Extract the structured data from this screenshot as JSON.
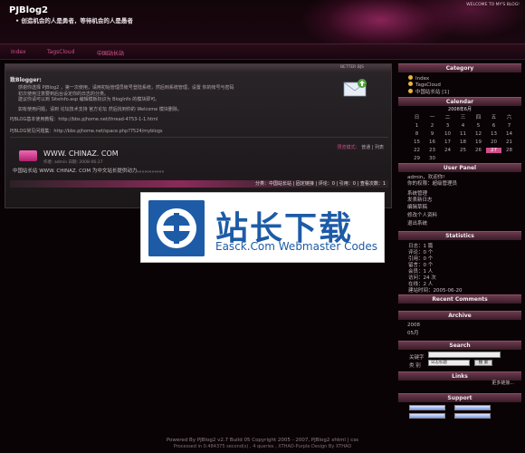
{
  "header": {
    "title": "PJBlog2",
    "subtitle": "• 创造机会的人是勇者，等待机会的人是愚者",
    "welcome": "WELCOME TO MY'S BLOG!"
  },
  "menu": {
    "items": [
      "Index",
      "TagsCloud",
      "中国站长站"
    ]
  },
  "content": {
    "bar_text": "BETTER BJS",
    "msg_title": "致Blogger:",
    "line1": "感谢你选择 PJBlog2 ，第一次使用，请用初始管理员帐号登陆系统，然后到系统管理，设置 你的帐号与密码",
    "line2": "初次使用注意要到后台设定你的日志的分类。",
    "line3": "建议你请可以到 SiteInfo.asp 编辑模板标识为 BlogInfo 的模块即可。",
    "line4": "如有使用问题，请到 论坛技术支持 官方论坛 然后找到你的 Welcome 模块删除。",
    "link1": "PJBLOG基本使用教程：http://bbs.pjhome.net/thread-4753-1-1.html",
    "link2": "PJBLOG常见问题集：http://bbs.pjhome.net/space.php?7524/myblogs",
    "article_meta": {
      "label": "预览模式：",
      "normal": "普通",
      "list": "列表"
    },
    "article_title": "WWW. CHINAZ. COM",
    "article_sub": "作者: admin 日期: 2008-06-27",
    "article_text": "中国站长站 WWW. CHINAZ. COM 为中文站长提供动力。。。。。。。。。。。",
    "article_foot": "分类：中国站长站 | 固定链接 | 评论：0 | 引用：0 | 查看次数：1"
  },
  "banner": {
    "title": "站长下载",
    "subtitle": "Easck.Com Webmaster Codes"
  },
  "sidebar": {
    "category": {
      "title": "Category",
      "items": [
        "Index",
        "TagsCloud",
        "中国站长站 [1]"
      ]
    },
    "calendar": {
      "title": "Calendar",
      "month": "2008年6月",
      "weekdays": [
        "日",
        "一",
        "二",
        "三",
        "四",
        "五",
        "六"
      ],
      "days": [
        "1",
        "2",
        "3",
        "4",
        "5",
        "6",
        "7",
        "8",
        "9",
        "10",
        "11",
        "12",
        "13",
        "14",
        "15",
        "16",
        "17",
        "18",
        "19",
        "20",
        "21",
        "22",
        "23",
        "24",
        "25",
        "26",
        "27",
        "28",
        "29",
        "30",
        "",
        "",
        "",
        "",
        ""
      ],
      "today": "27"
    },
    "userpanel": {
      "title": "User Panel",
      "line1": "admin，欢迎你!",
      "line2": "你的权限：超级管理员",
      "links": [
        "系统管理",
        "发表新日志",
        "编辑草稿",
        "修改个人资料",
        "退出系统"
      ]
    },
    "statistics": {
      "title": "Statistics",
      "items": [
        "日志：1 篇",
        "评论：0 个",
        "引用：0 个",
        "留言：0 个",
        "会员：1 人",
        "访问：24 次",
        "在线：2 人",
        "建站时间：2005-06-20"
      ]
    },
    "recent": {
      "title": "Recent Comments"
    },
    "archive": {
      "title": "Archive",
      "items": [
        "2008",
        "05月"
      ]
    },
    "search": {
      "title": "Search",
      "label1": "关键字",
      "label2": "类  别",
      "select": "日志标题",
      "button": "搜 索"
    },
    "links": {
      "title": "Links",
      "more": "更多链接..."
    },
    "support": {
      "title": "Support"
    }
  },
  "footer": {
    "line1": "Powered By PJBlog2 v2.7 Build 05 Copyright 2005 - 2007, PJBlog2 xhtml | css",
    "line2": "Processed in 0.484375 second(s) , 4 queries , XTHAO-Purple Design By XTHAO"
  }
}
